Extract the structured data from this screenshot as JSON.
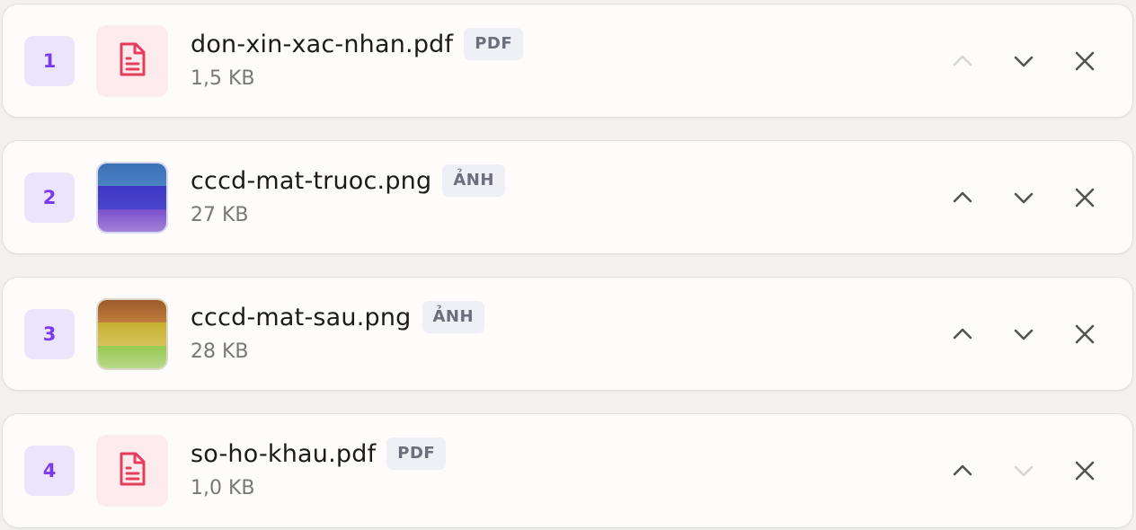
{
  "files": [
    {
      "index": "1",
      "name": "don-xin-xac-nhan.pdf",
      "type_tag": "PDF",
      "size": "1,5 KB",
      "thumb": "pdf-file-icon",
      "move_up_enabled": false,
      "move_down_enabled": true
    },
    {
      "index": "2",
      "name": "cccd-mat-truoc.png",
      "type_tag": "ẢNH",
      "size": "27 KB",
      "thumb": "image-thumbnail",
      "thumb_colors": [
        "#3d73b8",
        "#4338c8",
        "#8b5fcf"
      ],
      "move_up_enabled": true,
      "move_down_enabled": true
    },
    {
      "index": "3",
      "name": "cccd-mat-sau.png",
      "type_tag": "ẢNH",
      "size": "28 KB",
      "thumb": "image-thumbnail",
      "thumb_colors": [
        "#a65f2a",
        "#cfb32f",
        "#9ccc55"
      ],
      "move_up_enabled": true,
      "move_down_enabled": true
    },
    {
      "index": "4",
      "name": "so-ho-khau.pdf",
      "type_tag": "PDF",
      "size": "1,0 KB",
      "thumb": "pdf-file-icon",
      "move_up_enabled": true,
      "move_down_enabled": false
    }
  ],
  "colors": {
    "index_badge_bg": "#ebe4fb",
    "index_badge_text": "#7c3aed",
    "pdf_icon": "#e53e5c",
    "pdf_thumb_bg": "#fdebee",
    "action_icon": "#57534e",
    "action_icon_disabled": "#d8d6d2"
  }
}
